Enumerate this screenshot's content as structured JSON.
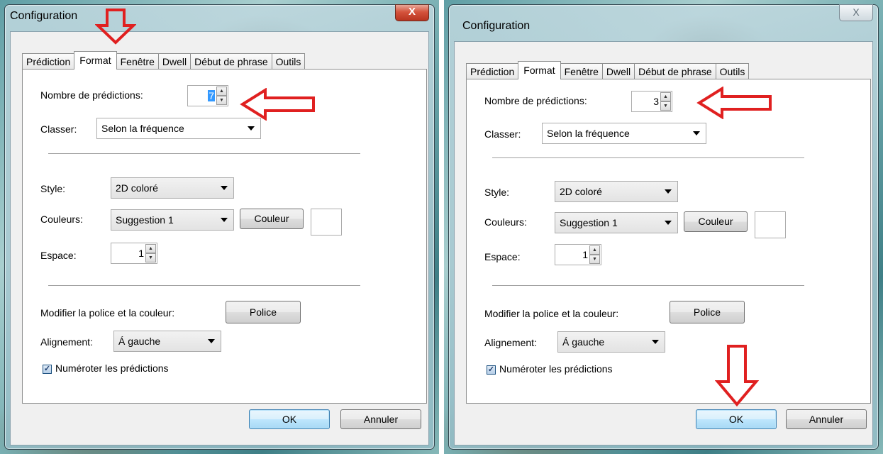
{
  "left_window": {
    "title": "Configuration",
    "close_label": "X",
    "tabs": [
      "Prédiction",
      "Format",
      "Fenêtre",
      "Dwell",
      "Début de phrase",
      "Outils"
    ],
    "predictions_label": "Nombre de prédictions:",
    "predictions_value": "7",
    "sort_label": "Classer:",
    "sort_value": "Selon la fréquence",
    "style_label": "Style:",
    "style_value": "2D coloré",
    "colors_label": "Couleurs:",
    "colors_value": "Suggestion 1",
    "color_button": "Couleur",
    "space_label": "Espace:",
    "space_value": "1",
    "font_label": "Modifier la police et la couleur:",
    "font_button": "Police",
    "align_label": "Alignement:",
    "align_value": "Á gauche",
    "number_checkbox_label": "Numéroter les prédictions",
    "ok_label": "OK",
    "cancel_label": "Annuler"
  },
  "right_window": {
    "title": "Configuration",
    "close_label": "X",
    "tabs": [
      "Prédiction",
      "Format",
      "Fenêtre",
      "Dwell",
      "Début de phrase",
      "Outils"
    ],
    "predictions_label": "Nombre de prédictions:",
    "predictions_value": "3",
    "sort_label": "Classer:",
    "sort_value": "Selon la fréquence",
    "style_label": "Style:",
    "style_value": "2D coloré",
    "colors_label": "Couleurs:",
    "colors_value": "Suggestion 1",
    "color_button": "Couleur",
    "space_label": "Espace:",
    "space_value": "1",
    "font_label": "Modifier la police et la couleur:",
    "font_button": "Police",
    "align_label": "Alignement:",
    "align_value": "Á gauche",
    "number_checkbox_label": "Numéroter les prédictions",
    "ok_label": "OK",
    "cancel_label": "Annuler"
  },
  "annotation_color": "#e02020",
  "accent_selection": "#3399ff"
}
